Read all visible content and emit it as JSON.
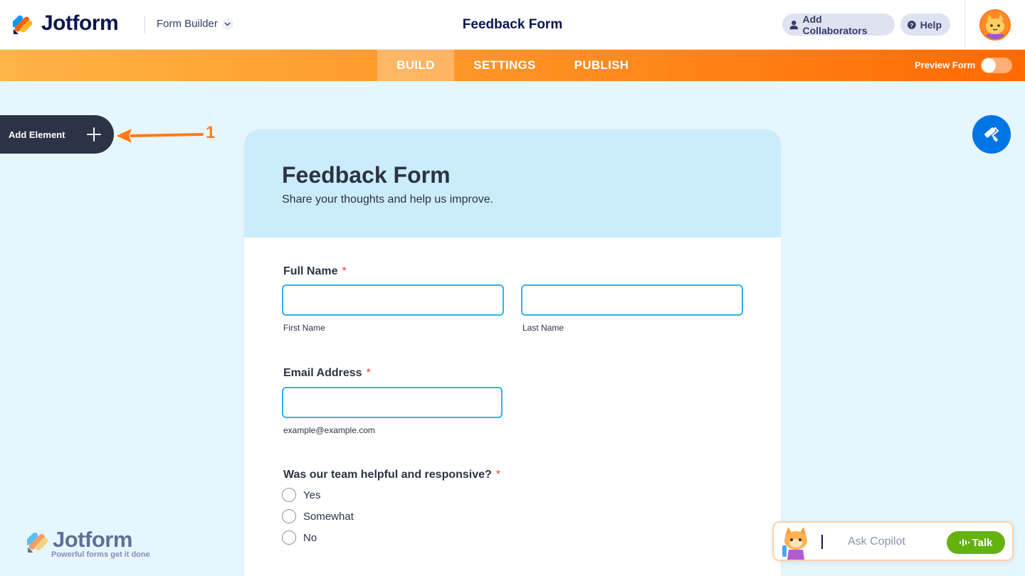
{
  "header": {
    "brand": "Jotform",
    "form_builder_label": "Form Builder",
    "page_title": "Feedback Form",
    "add_collaborators_label": "Add Collaborators",
    "help_label": "Help"
  },
  "nav": {
    "tabs": [
      {
        "label": "BUILD",
        "active": true
      },
      {
        "label": "SETTINGS",
        "active": false
      },
      {
        "label": "PUBLISH",
        "active": false
      }
    ],
    "preview_label": "Preview Form",
    "preview_on": false
  },
  "sidebar": {
    "add_element_label": "Add Element",
    "annotation_number": "1"
  },
  "form": {
    "title": "Feedback Form",
    "subtitle": "Share your thoughts and help us improve.",
    "full_name": {
      "label": "Full Name",
      "required_mark": "*",
      "first_sublabel": "First Name",
      "last_sublabel": "Last Name"
    },
    "email": {
      "label": "Email Address",
      "required_mark": "*",
      "sublabel": "example@example.com"
    },
    "helpful": {
      "label": "Was our team helpful and responsive?",
      "required_mark": "*",
      "options": [
        "Yes",
        "Somewhat",
        "No"
      ]
    }
  },
  "watermark": {
    "brand": "Jotform",
    "tagline": "Powerful forms get it done"
  },
  "copilot": {
    "placeholder": "Ask Copilot",
    "talk_label": "Talk"
  },
  "colors": {
    "brand_navy": "#0a1551",
    "orange": "#ff7d14",
    "input_border": "#2eb3e8",
    "required": "#f23a3c",
    "talk_green": "#64b20e",
    "designer_blue": "#0075e3"
  }
}
